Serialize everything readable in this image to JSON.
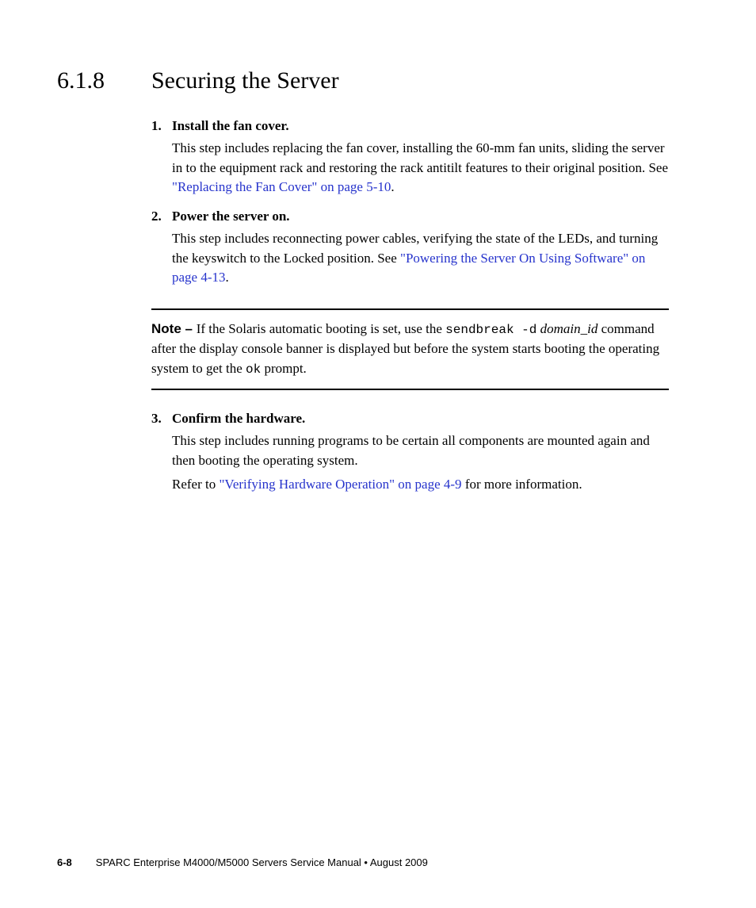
{
  "heading": {
    "number": "6.1.8",
    "title": "Securing the Server"
  },
  "steps": {
    "s1": {
      "num": "1.",
      "title": "Install the fan cover.",
      "p1_a": "This step includes replacing the fan cover, installing the 60-mm fan units, sliding the server in to the equipment rack and restoring the rack antitilt features to their original position. See ",
      "link": "\"Replacing the Fan Cover\" on page 5-10",
      "p1_b": "."
    },
    "s2": {
      "num": "2.",
      "title": "Power the server on.",
      "p1_a": "This step includes reconnecting power cables, verifying the state of the LEDs, and turning the keyswitch to the Locked position. See ",
      "link": "\"Powering the Server On Using Software\" on page 4-13",
      "p1_b": "."
    },
    "s3": {
      "num": "3.",
      "title": "Confirm the hardware.",
      "p1": "This step includes running programs to be certain all components are mounted again and then booting the operating system.",
      "p2_a": "Refer to ",
      "link": "\"Verifying Hardware Operation\" on page 4-9",
      "p2_b": " for more information."
    }
  },
  "note": {
    "label": "Note – ",
    "t1": "If the Solaris automatic booting is set, use the ",
    "cmd": "sendbreak -d",
    "space": " ",
    "arg": "domain_id",
    "t2": " command after the display console banner is displayed but before the system starts booting the operating system to get the ",
    "ok": "ok",
    "t3": " prompt."
  },
  "footer": {
    "page": "6-8",
    "title": "SPARC Enterprise M4000/M5000 Servers Service Manual  •  August 2009"
  }
}
